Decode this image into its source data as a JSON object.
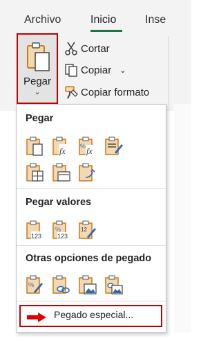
{
  "tabs": {
    "archivo": "Archivo",
    "inicio": "Inicio",
    "inse": "Inse"
  },
  "ribbon": {
    "pegar": "Pegar",
    "cortar": "Cortar",
    "copiar": "Copiar",
    "copiar_formato": "Copiar formato"
  },
  "menu": {
    "pegar_title": "Pegar",
    "valores_title": "Pegar valores",
    "otras_title": "Otras opciones de pegado",
    "especial": "Pegado especial...",
    "pegar_icons": [
      "paste-icon",
      "paste-formulas-icon",
      "paste-formulas-number-format-icon",
      "paste-keep-source-formatting-icon",
      "paste-no-borders-icon",
      "paste-keep-column-widths-icon",
      "paste-transpose-icon"
    ],
    "valores_icons": [
      "paste-values-icon",
      "paste-values-number-format-icon",
      "paste-values-source-formatting-icon"
    ],
    "otras_icons": [
      "paste-formatting-icon",
      "paste-link-icon",
      "paste-picture-icon",
      "paste-linked-picture-icon"
    ]
  },
  "colors": {
    "highlight": "#c00000",
    "accent": "#217346",
    "icon_orange": "#c8781e",
    "icon_blue": "#2b6cb0"
  }
}
